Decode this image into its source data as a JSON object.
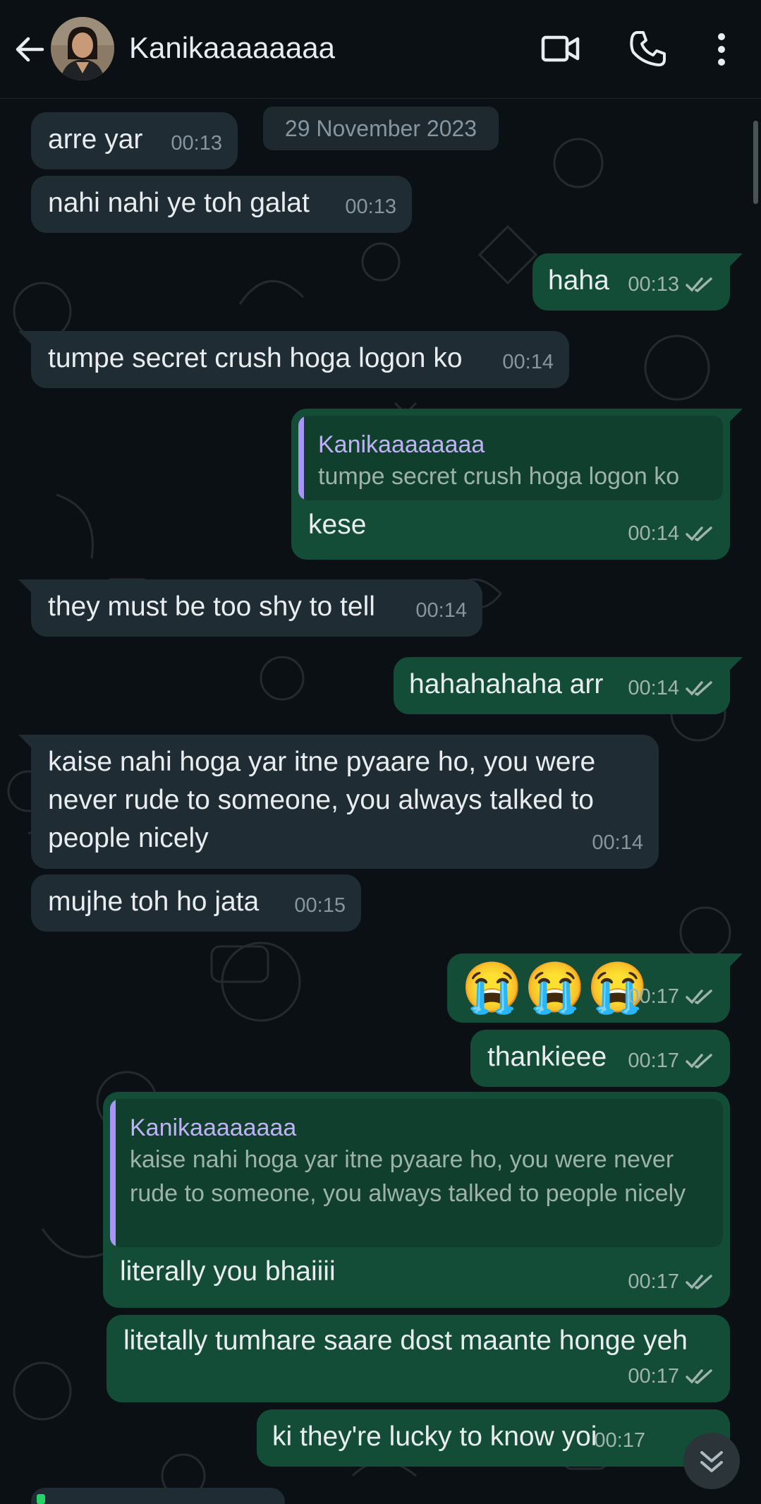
{
  "header": {
    "contact_name": "Kanikaaaaaaaa",
    "icons": [
      "back-arrow-icon",
      "avatar",
      "video-call-icon",
      "phone-icon",
      "more-vert-icon"
    ]
  },
  "date_chip": "29 November 2023",
  "messages": [
    {
      "dir": "in",
      "text": "arre yar",
      "time": "00:13"
    },
    {
      "dir": "in",
      "text": "nahi nahi ye toh galat",
      "time": "00:13"
    },
    {
      "dir": "out",
      "text": "haha",
      "time": "00:13"
    },
    {
      "dir": "in",
      "text": "tumpe secret crush hoga logon ko",
      "time": "00:14"
    },
    {
      "dir": "out",
      "quote_name": "Kanikaaaaaaaa",
      "quote_text": "tumpe secret crush hoga logon ko",
      "text": "kese",
      "time": "00:14"
    },
    {
      "dir": "in",
      "text": "they must be too shy to tell",
      "time": "00:14"
    },
    {
      "dir": "out",
      "text": "hahahahaha arr",
      "time": "00:14"
    },
    {
      "dir": "in",
      "text": "kaise nahi hoga yar itne pyaare ho, you were never rude to someone, you always talked to people nicely",
      "time": "00:14"
    },
    {
      "dir": "in",
      "text": "mujhe toh ho jata",
      "time": "00:15"
    },
    {
      "dir": "out",
      "text": "😭😭😭",
      "time": "00:17"
    },
    {
      "dir": "out",
      "text": "thankieee",
      "time": "00:17"
    },
    {
      "dir": "out",
      "quote_name": "Kanikaaaaaaaa",
      "quote_text": "kaise nahi hoga yar itne pyaare ho, you were never rude to someone, you always talked to people nicely",
      "text": "literally you bhaiiii",
      "time": "00:17"
    },
    {
      "dir": "out",
      "text": "litetally tumhare saare dost maante honge yeh",
      "time": "00:17"
    },
    {
      "dir": "out",
      "text": "ki they're lucky to know yoi",
      "time": "00:17"
    }
  ],
  "colors": {
    "bg": "#0b1014",
    "incoming": "#202c33",
    "outgoing": "#144d37",
    "quote_accent": "#a794f5",
    "ticks": "#9fb4ae"
  }
}
